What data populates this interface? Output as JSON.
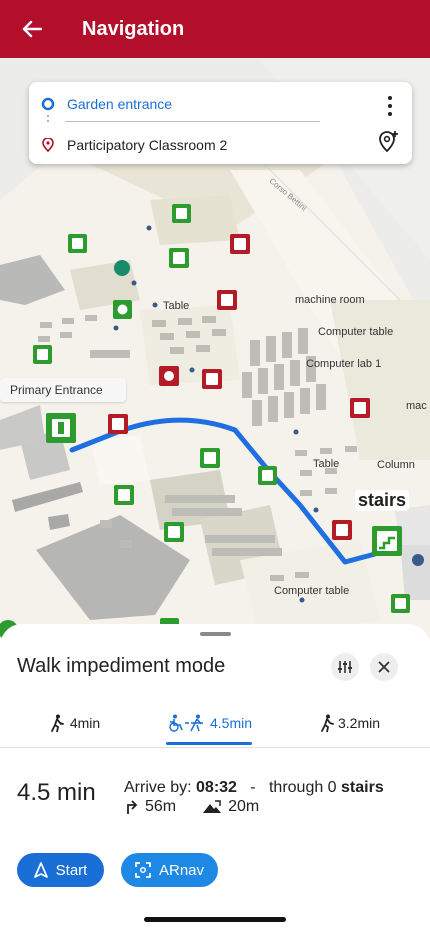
{
  "header": {
    "title": "Navigation"
  },
  "route": {
    "from": "Garden entrance",
    "to": "Participatory Classroom 2"
  },
  "map": {
    "labels": {
      "primary_entrance": "Primary Entrance",
      "stairs": "stairs",
      "table1": "Table",
      "machine_room": "machine room",
      "computer_table1": "Computer table",
      "computer_lab": "Computer lab 1",
      "mac": "mac",
      "table2": "Table",
      "column": "Column",
      "computer_table2": "Computer table",
      "road": "Corso Bettini"
    }
  },
  "sheet": {
    "title": "Walk impediment mode",
    "tabs": [
      {
        "label": "4min"
      },
      {
        "label": "4.5min"
      },
      {
        "label": "3.2min"
      }
    ],
    "duration": "4.5 min",
    "arrive_prefix": "Arrive by:",
    "arrive_time": "08:32",
    "separator": "-",
    "through_prefix": "through 0",
    "through_bold": "stairs",
    "distance": "56m",
    "elevation": "20m",
    "start_label": "Start",
    "arnav_label": "ARnav"
  },
  "colors": {
    "brand": "#b30f2b",
    "accent": "#1a6fd6",
    "route": "#1f6fe0"
  }
}
